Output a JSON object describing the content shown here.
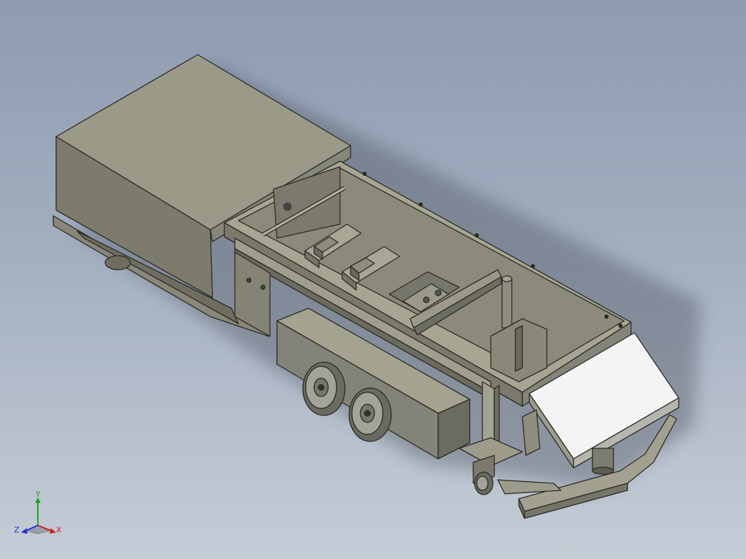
{
  "viewport": {
    "background_top": "#8e9bb0",
    "background_bottom": "#c5ccd6",
    "model_color": "#8a8878",
    "edge_color": "#2a2a24",
    "panel_white": "#f4f4f4"
  },
  "triad": {
    "x_label": "X",
    "y_label": "Y",
    "z_label": "Z",
    "x_color": "#d02020",
    "y_color": "#20a020",
    "z_color": "#2030d0"
  }
}
